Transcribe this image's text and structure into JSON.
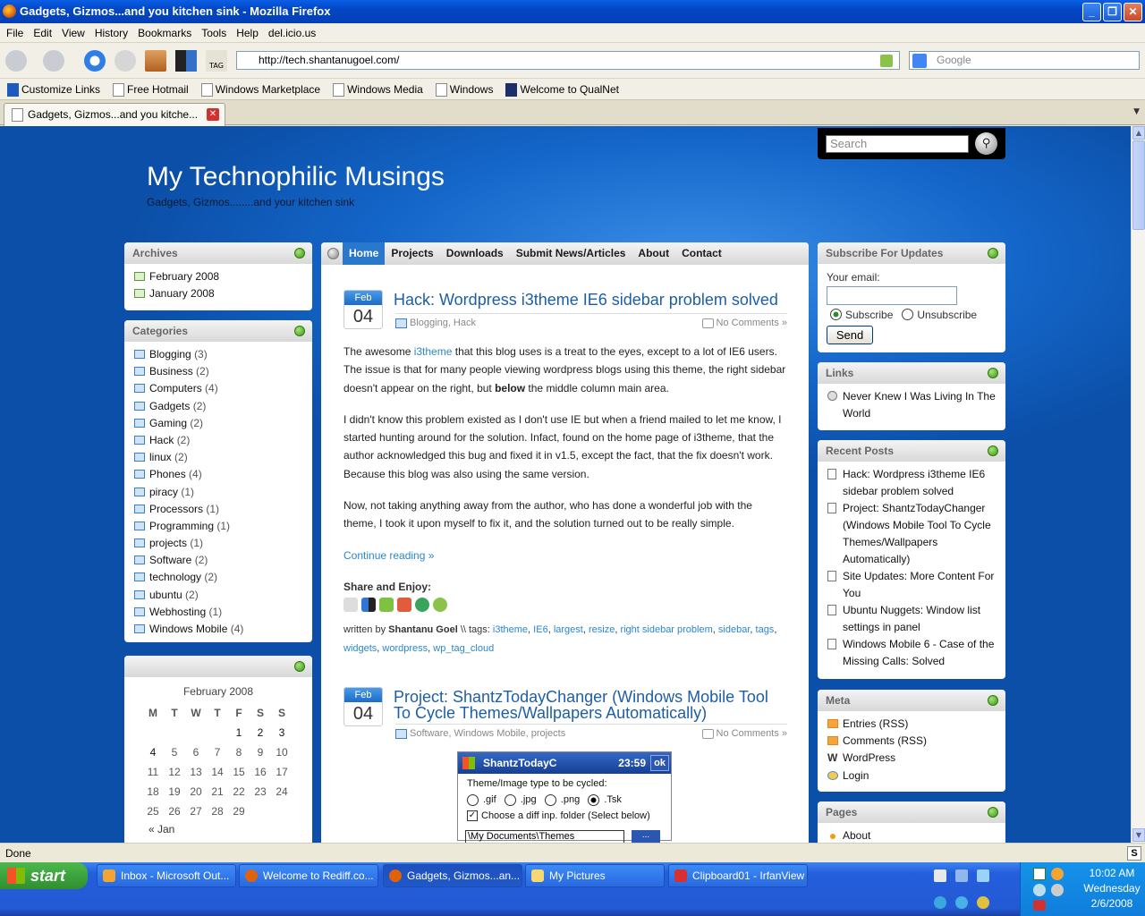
{
  "window": {
    "title": "Gadgets, Gizmos...and you kitchen sink - Mozilla Firefox"
  },
  "menu": [
    "File",
    "Edit",
    "View",
    "History",
    "Bookmarks",
    "Tools",
    "Help",
    "del.icio.us"
  ],
  "toolbar": {
    "url": "http://tech.shantanugoel.com/",
    "search_placeholder": "Google"
  },
  "bookmarks": [
    "Customize Links",
    "Free Hotmail",
    "Windows Marketplace",
    "Windows Media",
    "Windows",
    "Welcome to QualNet"
  ],
  "tab": {
    "title": "Gadgets, Gizmos...and you kitche..."
  },
  "blog": {
    "title": "My Technophilic Musings",
    "subtitle": "Gadgets, Gizmos........and your kitchen sink",
    "search_placeholder": "Search"
  },
  "archives": {
    "title": "Archives",
    "items": [
      "February 2008",
      "January 2008"
    ]
  },
  "categories": {
    "title": "Categories",
    "items": [
      {
        "name": "Blogging",
        "count": "(3)"
      },
      {
        "name": "Business",
        "count": "(2)"
      },
      {
        "name": "Computers",
        "count": "(4)"
      },
      {
        "name": "Gadgets",
        "count": "(2)"
      },
      {
        "name": "Gaming",
        "count": "(2)"
      },
      {
        "name": "Hack",
        "count": "(2)"
      },
      {
        "name": "linux",
        "count": "(2)"
      },
      {
        "name": "Phones",
        "count": "(4)"
      },
      {
        "name": "piracy",
        "count": "(1)"
      },
      {
        "name": "Processors",
        "count": "(1)"
      },
      {
        "name": "Programming",
        "count": "(1)"
      },
      {
        "name": "projects",
        "count": "(1)"
      },
      {
        "name": "Software",
        "count": "(2)"
      },
      {
        "name": "technology",
        "count": "(2)"
      },
      {
        "name": "ubuntu",
        "count": "(2)"
      },
      {
        "name": "Webhosting",
        "count": "(1)"
      },
      {
        "name": "Windows Mobile",
        "count": "(4)"
      }
    ]
  },
  "calendar": {
    "caption": "February 2008",
    "days": [
      "M",
      "T",
      "W",
      "T",
      "F",
      "S",
      "S"
    ],
    "weeks": [
      [
        "",
        "",
        "",
        "",
        "1",
        "2",
        "3"
      ],
      [
        "4",
        "5",
        "6",
        "7",
        "8",
        "9",
        "10"
      ],
      [
        "11",
        "12",
        "13",
        "14",
        "15",
        "16",
        "17"
      ],
      [
        "18",
        "19",
        "20",
        "21",
        "22",
        "23",
        "24"
      ],
      [
        "25",
        "26",
        "27",
        "28",
        "29",
        "",
        ""
      ]
    ],
    "prev": "« Jan"
  },
  "nav": [
    "Home",
    "Projects",
    "Downloads",
    "Submit News/Articles",
    "About",
    "Contact"
  ],
  "post1": {
    "month": "Feb",
    "day": "04",
    "title": "Hack: Wordpress i3theme IE6 sidebar problem solved",
    "cats": "Blogging, Hack",
    "comments": "No Comments »",
    "p1_a": "The awesome ",
    "p1_link": "i3theme",
    "p1_b": " that this blog uses is a treat to the eyes, except to a lot of IE6 users. The issue is that for many people viewing wordpress blogs using this theme, the right sidebar doesn't appear on the right, but ",
    "p1_bold": "below",
    "p1_c": " the middle column main area.",
    "p2": "I didn't know this problem existed as I don't use IE but when a friend mailed to let me know, I started hunting around for the solution. Infact, found on the home page of i3theme, that the author acknowledged this bug and fixed it in v1.5, except the fact, that the fix doesn't work. Because this blog was also using the same version.",
    "p3": "Now, not taking anything away from the author, who has done a wonderful job with the theme, I took it upon myself to fix it, and the solution turned out to be really simple.",
    "continue": "Continue reading »",
    "share": "Share and Enjoy:",
    "written_prefix": "written by ",
    "author": "Shantanu Goel",
    "tags_prefix": " \\\\ tags: ",
    "tags": [
      "i3theme",
      "IE6",
      "largest",
      "resize",
      "right sidebar problem",
      "sidebar",
      "tags",
      "widgets",
      "wordpress",
      "wp_tag_cloud"
    ]
  },
  "post2": {
    "month": "Feb",
    "day": "04",
    "title": "Project: ShantzTodayChanger (Windows Mobile Tool To Cycle Themes/Wallpapers Automatically)",
    "cats": "Software, Windows Mobile, projects",
    "comments": "No Comments »",
    "shot": {
      "app": "ShantzTodayC",
      "time": "23:59",
      "ok": "ok",
      "label": "Theme/Image type to be cycled:",
      "options": [
        ".gif",
        ".jpg",
        ".png",
        ".Tsk"
      ],
      "checkbox": "Choose a diff inp. folder (Select below)",
      "folder": "\\My Documents\\Themes",
      "browse": "..."
    }
  },
  "subscribe": {
    "title": "Subscribe For Updates",
    "email_label": "Your email:",
    "opt1": "Subscribe",
    "opt2": "Unsubscribe",
    "send": "Send"
  },
  "links": {
    "title": "Links",
    "items": [
      "Never Knew I Was Living In The World"
    ]
  },
  "recent": {
    "title": "Recent Posts",
    "items": [
      "Hack: Wordpress i3theme IE6 sidebar problem solved",
      "Project: ShantzTodayChanger (Windows Mobile Tool To Cycle Themes/Wallpapers Automatically)",
      "Site Updates: More Content For You",
      "Ubuntu Nuggets: Window list settings in panel",
      "Windows Mobile 6 - Case of the Missing Calls: Solved"
    ]
  },
  "meta": {
    "title": "Meta",
    "items": [
      "Entries (RSS)",
      "Comments (RSS)",
      "WordPress",
      "Login"
    ]
  },
  "pages": {
    "title": "Pages",
    "items": [
      "About"
    ]
  },
  "status": "Done",
  "taskbar": {
    "start": "start",
    "buttons": [
      "Inbox - Microsoft Out...",
      "Welcome to Rediff.co...",
      "Gadgets, Gizmos...an...",
      "My Pictures",
      "Clipboard01 - IrfanView"
    ],
    "time": "10:02 AM",
    "weekday": "Wednesday",
    "date": "2/6/2008"
  },
  "colors": {
    "accent": "#2a78cc",
    "link": "#2a87d0",
    "title": "#1d5ea8"
  }
}
